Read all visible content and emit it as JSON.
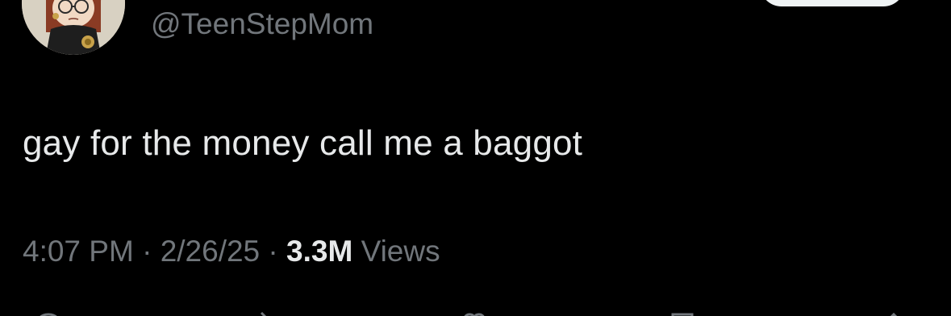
{
  "tweet": {
    "handle": "@TeenStepMom",
    "text": "gay for the money call me a baggot",
    "time": "4:07 PM",
    "separator": " · ",
    "date": "2/26/25",
    "views_count": "3.3M",
    "views_label": "Views"
  },
  "follow_button": {
    "label": ""
  },
  "icons": {
    "avatar": "avatar-illustration",
    "actions": [
      "reply-icon",
      "retweet-icon",
      "like-icon",
      "bookmark-icon",
      "share-icon"
    ]
  },
  "colors": {
    "background": "#000000",
    "primary_text": "#e7e9ea",
    "secondary_text": "#71767b",
    "button_bg": "#eff3f4"
  }
}
